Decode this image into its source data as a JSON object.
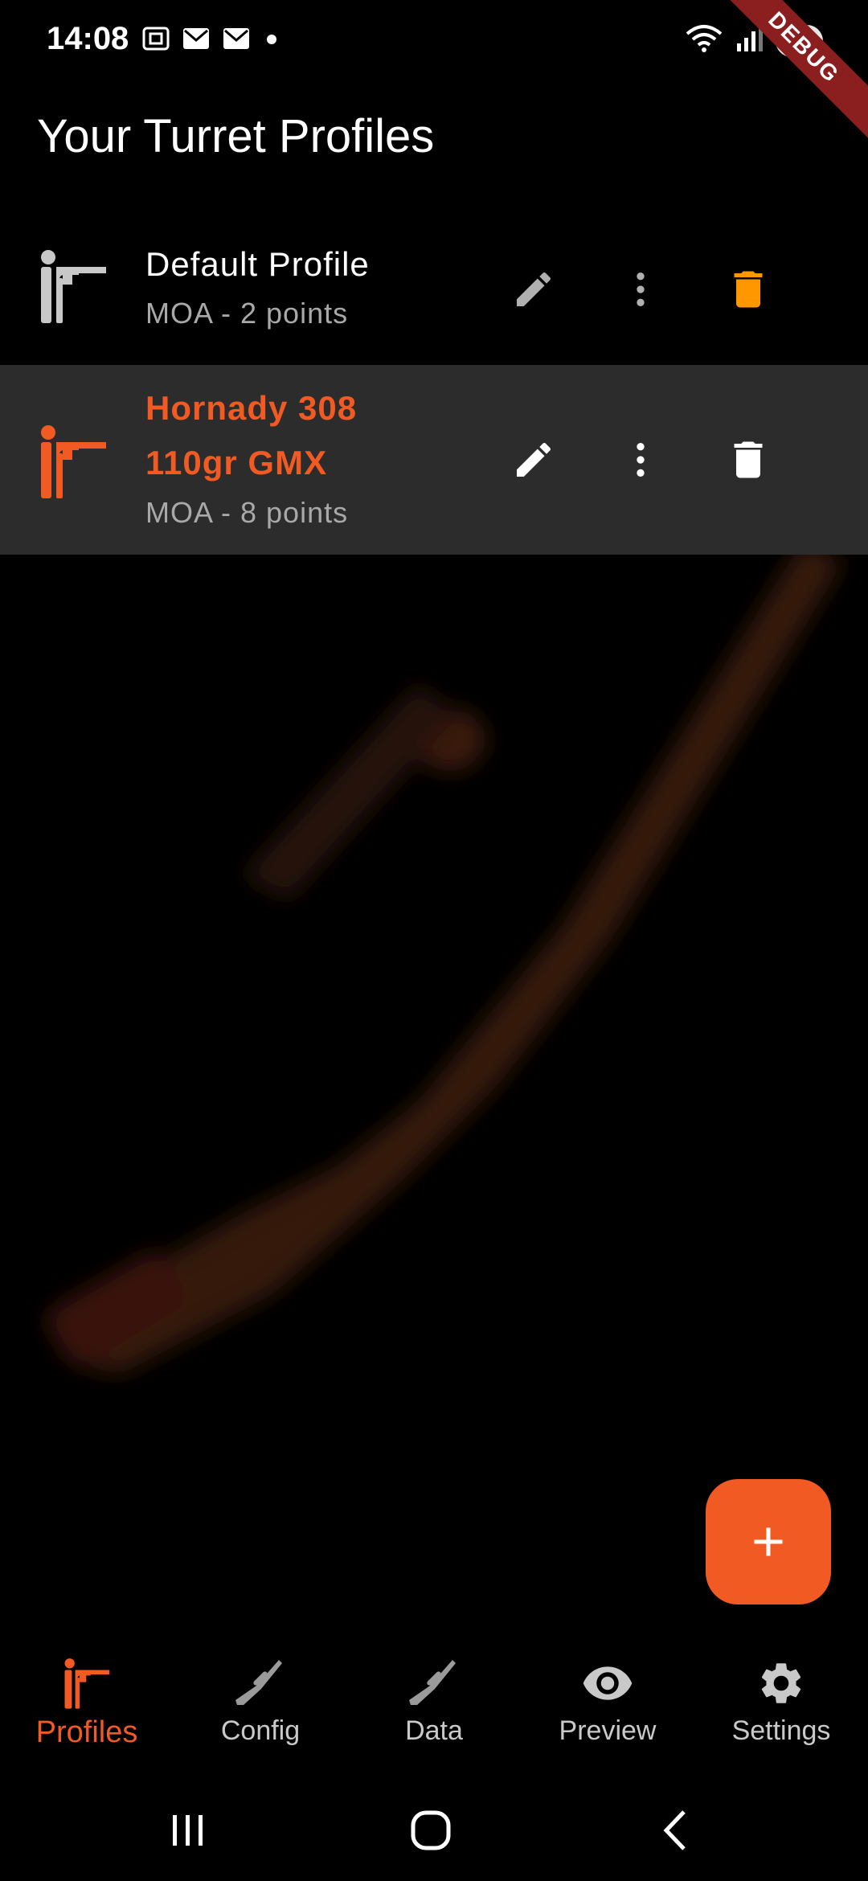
{
  "status_bar": {
    "time": "14:08",
    "battery": "94",
    "debug_banner": "DEBUG",
    "icons": [
      "screenshot-icon",
      "mail-icon",
      "mail-icon",
      "dot-icon",
      "wifi-icon",
      "signal-icon",
      "battery-icon"
    ]
  },
  "page": {
    "title": "Your Turret Profiles"
  },
  "profiles": [
    {
      "name": "Default Profile",
      "subtitle": "MOA - 2 points",
      "active": false,
      "icon": "shooter-icon",
      "delete_color": "#ff9800"
    },
    {
      "name": "Hornady 308 110gr GMX",
      "name_line1": "Hornady 308",
      "name_line2": "110gr GMX",
      "subtitle": "MOA - 8 points",
      "active": true,
      "icon": "shooter-icon",
      "delete_color": "#ffffff"
    }
  ],
  "fab": {
    "label": "+",
    "icon": "add-icon"
  },
  "bottom_nav": {
    "items": [
      {
        "label": "Profiles",
        "icon": "shooter-icon",
        "active": true
      },
      {
        "label": "Config",
        "icon": "rifle-icon",
        "active": false
      },
      {
        "label": "Data",
        "icon": "rifle-icon",
        "active": false
      },
      {
        "label": "Preview",
        "icon": "eye-icon",
        "active": false
      },
      {
        "label": "Settings",
        "icon": "gear-icon",
        "active": false
      }
    ]
  },
  "colors": {
    "accent": "#f15a22",
    "background": "#000000",
    "selected_row": "#2c2c2c",
    "delete_accent": "#ff9800"
  }
}
